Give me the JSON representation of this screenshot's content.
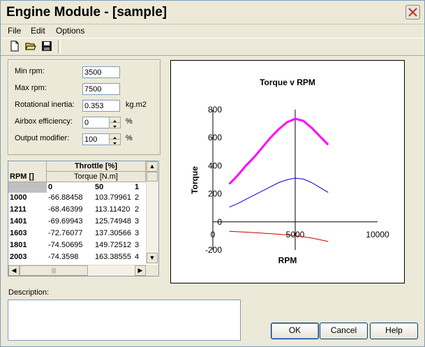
{
  "window": {
    "title": "Engine Module - [sample]"
  },
  "menu": [
    "File",
    "Edit",
    "Options"
  ],
  "toolbar": {
    "new_icon": "new-document-icon",
    "open_icon": "open-folder-icon",
    "save_icon": "save-disk-icon"
  },
  "params": {
    "min_rpm": {
      "label": "Min rpm:",
      "value": "3500"
    },
    "max_rpm": {
      "label": "Max rpm:",
      "value": "7500"
    },
    "inertia": {
      "label": "Rotational inertia:",
      "value": "0.353",
      "unit": "kg.m2"
    },
    "airbox": {
      "label": "Airbox efficiency:",
      "value": "0",
      "unit": "%"
    },
    "modifier": {
      "label": "Output modifier:",
      "value": "100",
      "unit": "%"
    }
  },
  "grid": {
    "corner": "RPM []",
    "group_header": "Throttle [%]",
    "sub_header": "Torque [N.m]",
    "columns": [
      "0",
      "50",
      "1"
    ],
    "rows": [
      {
        "rpm": "1000",
        "cells": [
          "-66.88458",
          "103.79961",
          "2"
        ]
      },
      {
        "rpm": "1211",
        "cells": [
          "-68.46399",
          "113.11420",
          "2"
        ]
      },
      {
        "rpm": "1401",
        "cells": [
          "-69.69943",
          "125.74948",
          "3"
        ]
      },
      {
        "rpm": "1603",
        "cells": [
          "-72.76077",
          "137.30566",
          "3"
        ]
      },
      {
        "rpm": "1801",
        "cells": [
          "-74.50695",
          "149.72512",
          "3"
        ]
      },
      {
        "rpm": "2003",
        "cells": [
          "-74.3598",
          "163.38555",
          "4"
        ]
      }
    ]
  },
  "chart_data": {
    "type": "line",
    "title": "Torque v RPM",
    "xlabel": "RPM",
    "ylabel": "Torque",
    "xlim": [
      0,
      10000
    ],
    "ylim": [
      -200,
      800
    ],
    "xticks": [
      "0",
      "5000",
      "10000"
    ],
    "yticks": [
      "-200",
      "0",
      "200",
      "400",
      "600",
      "800"
    ],
    "series": [
      {
        "color": "#ff00ff",
        "width": 3,
        "x": [
          1000,
          1500,
          2000,
          2500,
          3000,
          3500,
          4000,
          4500,
          5000,
          5500,
          6000,
          6500,
          7000
        ],
        "y": [
          270,
          330,
          400,
          460,
          530,
          600,
          660,
          710,
          735,
          720,
          670,
          610,
          550
        ]
      },
      {
        "color": "#0000cc",
        "width": 1,
        "x": [
          1000,
          1500,
          2000,
          2500,
          3000,
          3500,
          4000,
          4500,
          5000,
          5500,
          6000,
          6500,
          7000
        ],
        "y": [
          105,
          130,
          160,
          190,
          220,
          250,
          280,
          300,
          312,
          305,
          280,
          245,
          210
        ]
      },
      {
        "color": "#cc0000",
        "width": 1,
        "x": [
          1000,
          2000,
          3000,
          4000,
          5000,
          6000,
          7000
        ],
        "y": [
          -67,
          -73,
          -80,
          -88,
          -98,
          -115,
          -140
        ]
      }
    ],
    "grid": false
  },
  "description": {
    "label": "Description:",
    "value": ""
  },
  "buttons": {
    "ok": "OK",
    "cancel": "Cancel",
    "help": "Help"
  }
}
